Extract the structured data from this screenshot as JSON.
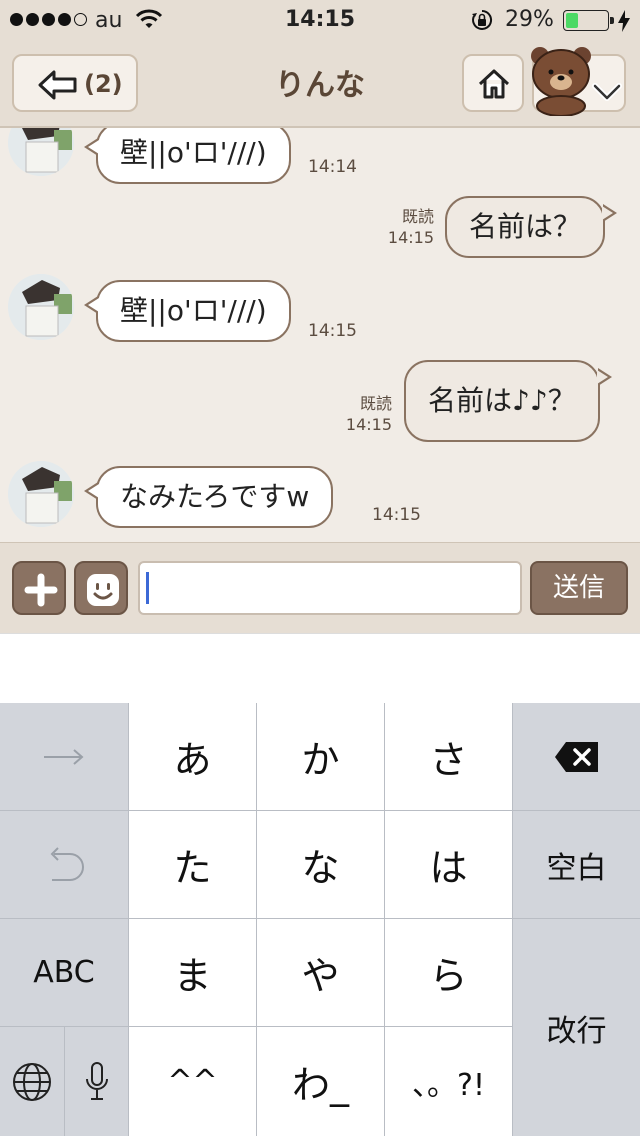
{
  "status_bar": {
    "carrier": "au",
    "time": "14:15",
    "battery_percent": "29%",
    "battery_level": 0.29,
    "signal_bars_filled": 4,
    "signal_bars_total": 5
  },
  "nav": {
    "back_count": "(2)",
    "title": "りんな"
  },
  "messages": [
    {
      "direction": "in",
      "text": "壁||o'ロ'///)",
      "time": "14:14"
    },
    {
      "direction": "out",
      "text": "名前は？",
      "read": "既読",
      "time": "14:15"
    },
    {
      "direction": "in",
      "text": "壁||o'ロ'///)",
      "time": "14:15"
    },
    {
      "direction": "out",
      "text": "名前は♪♪？",
      "read": "既読",
      "time": "14:15"
    },
    {
      "direction": "in",
      "text": "なみたろですw",
      "time": "14:15"
    }
  ],
  "input": {
    "value": "",
    "send_label": "送信"
  },
  "keyboard": {
    "row1": [
      "→",
      "あ",
      "か",
      "さ",
      "⌫"
    ],
    "row2": [
      "↶",
      "た",
      "な",
      "は",
      "空白"
    ],
    "row3": [
      "ABC",
      "ま",
      "や",
      "ら"
    ],
    "return": "改行",
    "row4": [
      "🌐",
      "🎤",
      "^^",
      "わ_",
      "、。?!"
    ]
  },
  "colors": {
    "bar_bg": "#e6ded4",
    "chat_bg": "#f1ece6",
    "bubble_border": "#8a7361",
    "button_brown": "#8a7262",
    "title_brown": "#5a4636",
    "battery_green": "#4cd964"
  },
  "icons": [
    "back-arrow-icon",
    "home-icon",
    "bear-sticker-icon",
    "chevron-down-icon",
    "plus-icon",
    "smiley-icon",
    "wifi-icon",
    "rotation-lock-icon",
    "charging-bolt-icon",
    "globe-icon",
    "microphone-icon",
    "delete-icon",
    "undo-icon",
    "arrow-right-icon"
  ]
}
